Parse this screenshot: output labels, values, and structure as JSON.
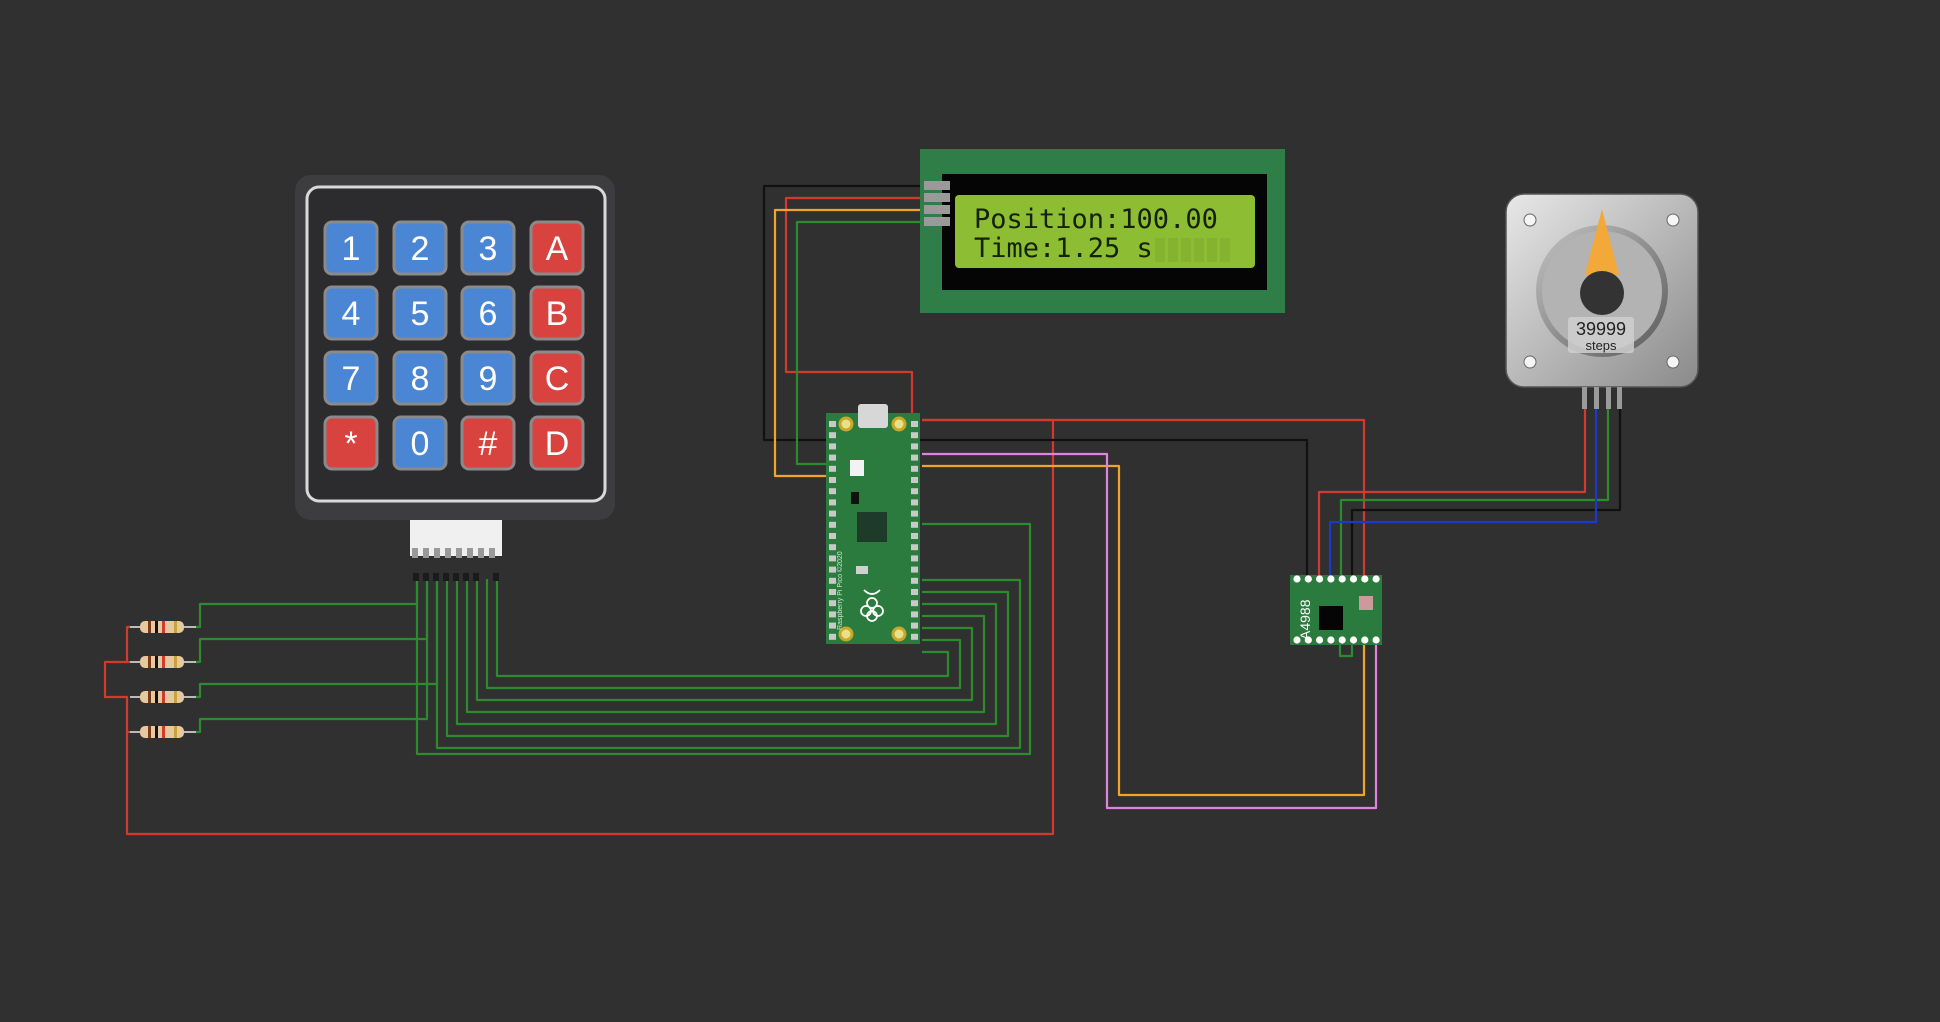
{
  "lcd": {
    "line1": "Position:100.00",
    "line2": "Time:1.25 s"
  },
  "keypad": {
    "keys": [
      "1",
      "2",
      "3",
      "A",
      "4",
      "5",
      "6",
      "B",
      "7",
      "8",
      "9",
      "C",
      "*",
      "0",
      "#",
      "D"
    ]
  },
  "motor": {
    "steps_value": "39999",
    "steps_unit": "steps"
  },
  "driver": {
    "label": "A4988"
  },
  "pico": {
    "silk_label": "Raspberry Pi Pico ©2020"
  },
  "colors": {
    "background": "#303030",
    "lcd_board": "#2f7d47",
    "lcd_screen": "#8dbd33",
    "pico_board": "#2b7a3e",
    "key_blue": "#4b86d4",
    "key_red": "#d8423f",
    "wire_red": "#d23a2e",
    "wire_black": "#111111",
    "wire_green": "#2c8a2f",
    "wire_orange": "#f0a528",
    "wire_pink": "#e083e0",
    "wire_blue": "#1d39c8",
    "motor_pointer": "#f2a93a"
  }
}
